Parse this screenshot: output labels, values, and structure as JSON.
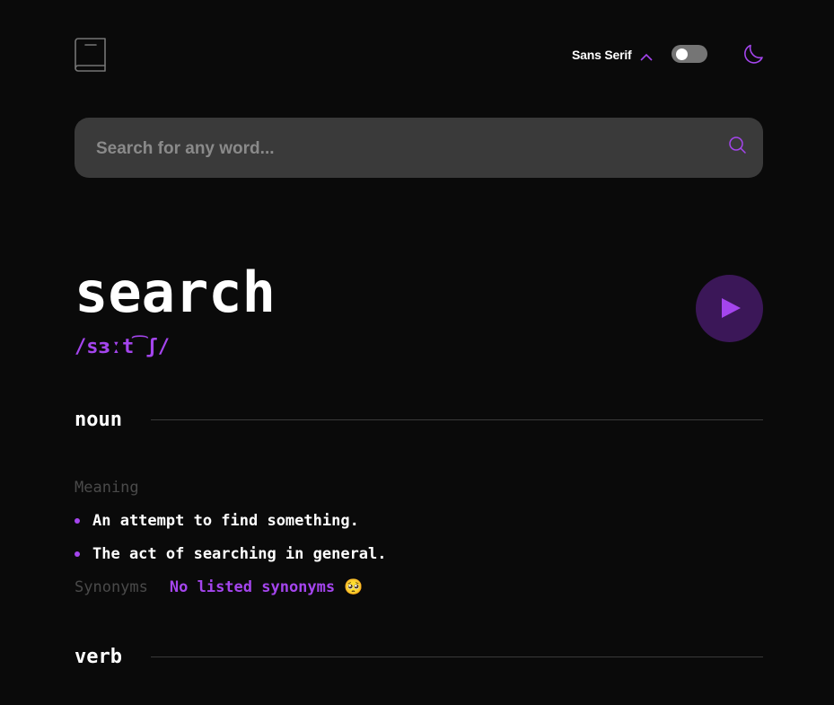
{
  "header": {
    "font_label": "Sans Serif",
    "theme_toggle_on": false,
    "icons": {
      "logo": "book-icon",
      "font_chevron": "chevron-up-icon",
      "theme": "moon-icon"
    }
  },
  "search": {
    "placeholder": "Search for any word...",
    "value": "",
    "icon": "search-icon"
  },
  "entry": {
    "word": "search",
    "phonetic": "/sɜːt͡ʃ/",
    "play_icon": "play-icon",
    "meanings": [
      {
        "part_of_speech": "noun",
        "meaning_heading": "Meaning",
        "definitions": [
          "An attempt to find something.",
          "The act of searching in general."
        ],
        "synonyms_label": "Synonyms",
        "synonyms_value": "No listed synonyms",
        "synonyms_emoji": "🥺"
      },
      {
        "part_of_speech": "verb"
      }
    ]
  },
  "colors": {
    "background": "#0a0a0a",
    "accent": "#a445ed",
    "search_bg": "#3a3a3a",
    "muted": "#4a4a4a",
    "play_bg": "#3b1758"
  }
}
